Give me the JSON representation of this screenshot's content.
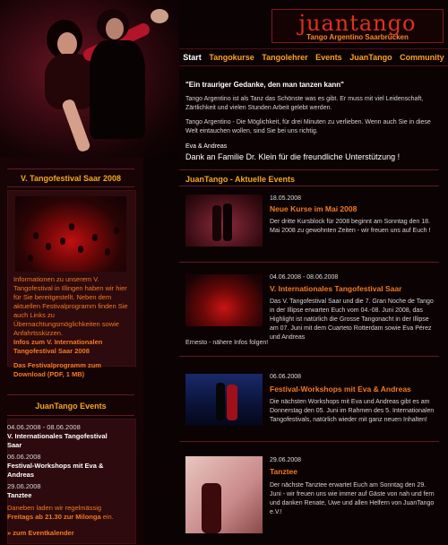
{
  "header": {
    "logo_name": "juantango",
    "logo_sub": "Tango Argentino Saarbrücken"
  },
  "nav": [
    {
      "label": "Start",
      "active": true
    },
    {
      "label": "Tangokurse"
    },
    {
      "label": "Tangolehrer"
    },
    {
      "label": "Events"
    },
    {
      "label": "JuanTango"
    },
    {
      "label": "Community"
    }
  ],
  "intro": {
    "quote": "\"Ein trauriger Gedanke, den man tanzen kann\"",
    "para1": "Tango Argentino ist als Tanz das Schönste was es gibt. Er muss mit viel Leidenschaft, Zärtlichkeit und vielen Stunden Arbeit gelebt werden.",
    "para2": "Tango Argentino - Die Möglichkeit, für drei Minuten zu verlieben. Wenn auch Sie in diese Welt eintauchen wollen, sind Sie bei uns richtig.",
    "signature": "Eva & Andreas",
    "thanks": "Dank an Familie Dr. Klein für die freundliche Unterstützung !"
  },
  "festival": {
    "title": "V. Tangofestival Saar 2008",
    "text": "Informationen zu unserem V. Tangofestival in Illingen haben wir hier für Sie bereitgestellt. Neben dem aktuellen Festivalprogramm finden Sie auch Links zu Übernachtungsmöglichkeiten sowie Anfahrtsskizzen.",
    "link1": "Infos zum V. Internationalen Tangofestival Saar 2008",
    "link2": "Das Festivalprogramm zum Download (PDF, 1 MB)"
  },
  "side_events": {
    "title": "JuanTango Events",
    "items": [
      {
        "date": "04.06.2008 - 08.06.2008",
        "title": "V. Internationales Tangofestival Saar"
      },
      {
        "date": "06.06.2008",
        "title": "Festival-Workshops mit Eva & Andreas"
      },
      {
        "date": "29.06.2008",
        "title": "Tanztee"
      }
    ],
    "regular_prefix": "Daneben laden wir regelmässig",
    "regular_bold": "Freitags ab 21.30 zur Milonga",
    "regular_suffix": "ein.",
    "calendar_link": "» zum Eventkalender"
  },
  "events": {
    "title": "JuanTango - Aktuelle Events",
    "items": [
      {
        "date": "18.05.2008",
        "title": "Neue Kurse im Mai 2008",
        "text": "Der dritte Kursblock für 2008 beginnt am Sonntag den 18. Mai 2008 zu gewohnten Zeiten - wir freuen uns auf Euch !"
      },
      {
        "date": "04.06.2008 - 08.06.2008",
        "title": "V. Internationales Tangofestival Saar",
        "text": "Das V. Tangofestival Saar und die 7. Gran Noche de Tango in der Illipse erwarten Euch vom 04.-08. Juni 2008, das Highlight ist natürlich die Grosse Tangonacht in der Illipse am 07. Juni mit dem Cuarteto Rotterdam sowie Eva Pérez und Andreas",
        "text_cont": "Ernesto - nähere Infos folgen!"
      },
      {
        "date": "06.06.2008",
        "title": "Festival-Workshops mit Eva & Andreas",
        "text": "Die nächsten Workshops mit Eva und Andreas gibt es am Donnerstag den 05. Juni im Rahmen des 5. Internationalen Tangofestivals, natürlich wieder mit ganz neuen Inhalten!"
      },
      {
        "date": "29.06.2008",
        "title": "Tanztee",
        "text": "Der nächste Tanztee erwartet Euch am Sonntag den 29. Juni - wir freuen uns wie immer auf Gäste von nah und fern und danken Renate, Uwe und allen Helfern von JuanTango e.V.!"
      }
    ]
  },
  "colors": {
    "accent": "#f4a81f",
    "link": "#f47a1f",
    "background": "#0b0204"
  }
}
